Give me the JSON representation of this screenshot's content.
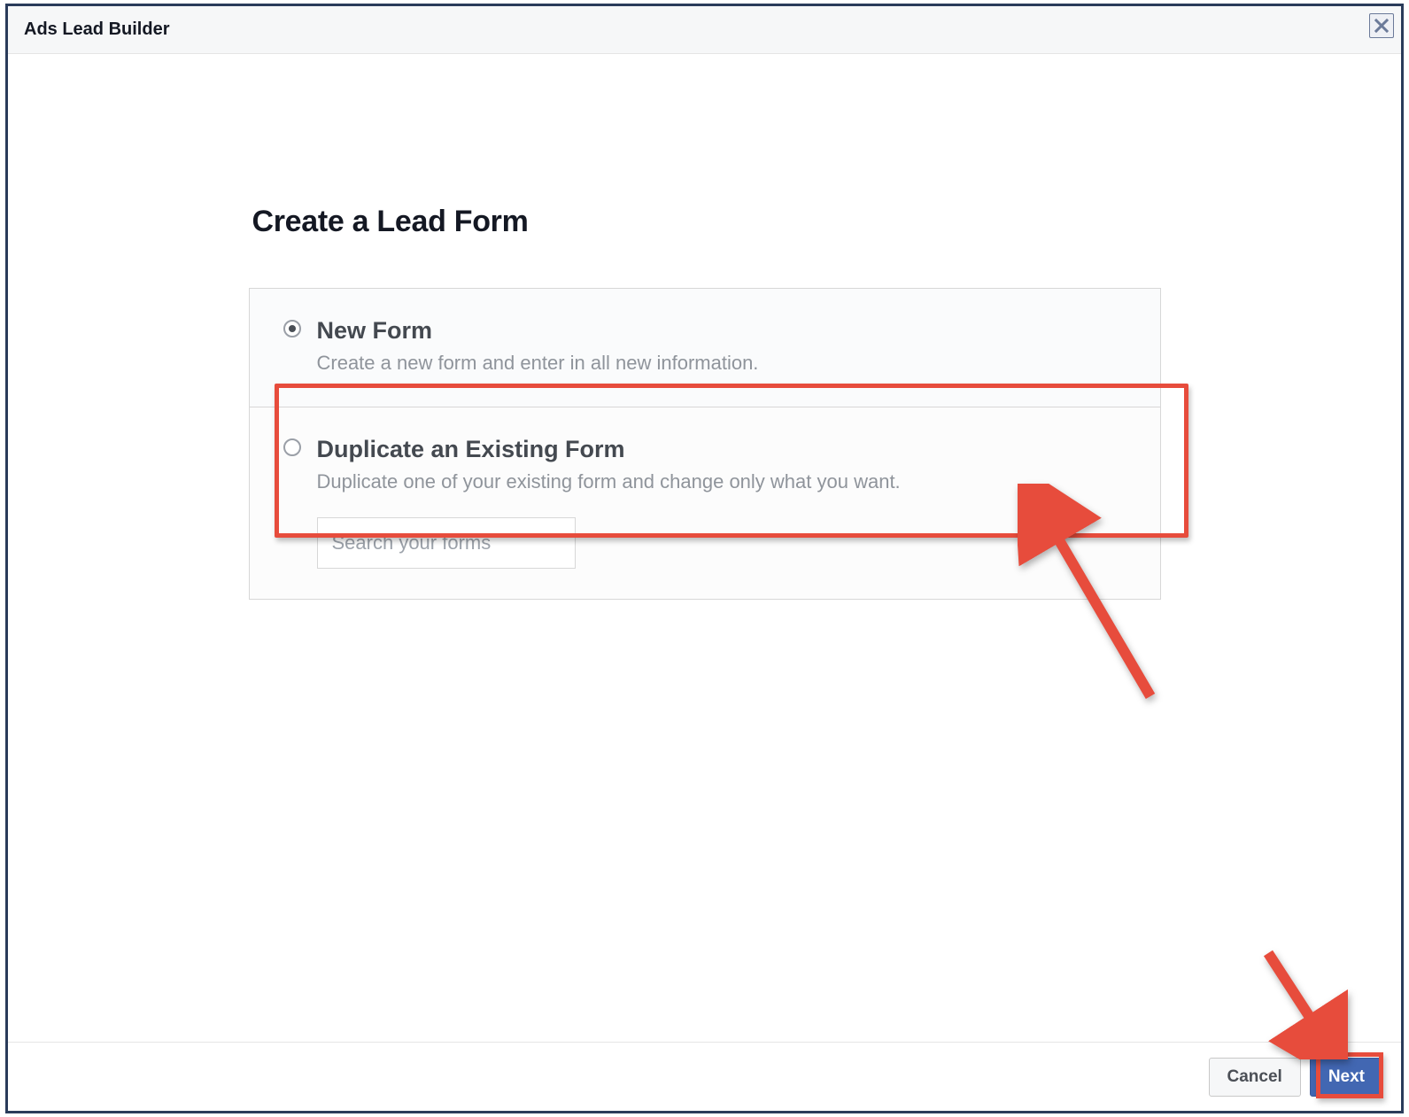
{
  "modal": {
    "title": "Ads Lead Builder",
    "close_label": "Close"
  },
  "page": {
    "heading": "Create a Lead Form"
  },
  "options": {
    "new_form": {
      "label": "New Form",
      "description": "Create a new form and enter in all new information.",
      "selected": true
    },
    "duplicate": {
      "label": "Duplicate an Existing Form",
      "description": "Duplicate one of your existing form and change only what you want.",
      "selected": false,
      "search_placeholder": "Search your forms"
    }
  },
  "footer": {
    "cancel": "Cancel",
    "next": "Next"
  },
  "annotation": {
    "color": "#e74c3c"
  }
}
